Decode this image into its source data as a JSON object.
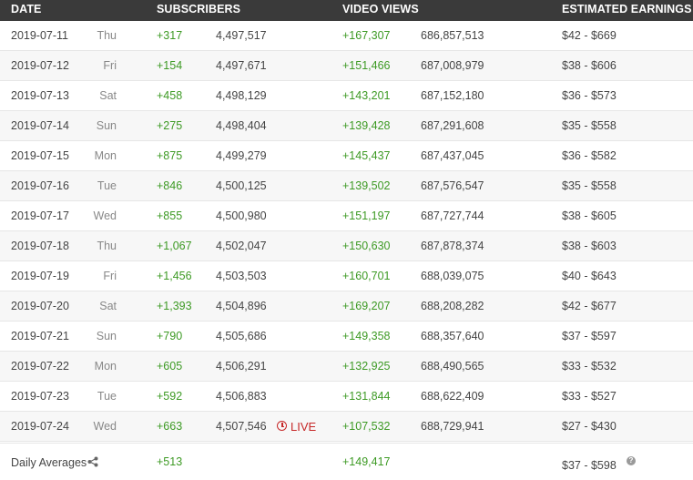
{
  "header": {
    "date": "DATE",
    "subscribers": "SUBSCRIBERS",
    "video_views": "VIDEO VIEWS",
    "estimated_earnings": "ESTIMATED EARNINGS"
  },
  "rows": [
    {
      "date": "2019-07-11",
      "day": "Thu",
      "sub_delta": "+317",
      "subs": "4,497,517",
      "views_delta": "+167,307",
      "views": "686,857,513",
      "earnings": "$42  -  $669"
    },
    {
      "date": "2019-07-12",
      "day": "Fri",
      "sub_delta": "+154",
      "subs": "4,497,671",
      "views_delta": "+151,466",
      "views": "687,008,979",
      "earnings": "$38  -  $606"
    },
    {
      "date": "2019-07-13",
      "day": "Sat",
      "sub_delta": "+458",
      "subs": "4,498,129",
      "views_delta": "+143,201",
      "views": "687,152,180",
      "earnings": "$36  -  $573"
    },
    {
      "date": "2019-07-14",
      "day": "Sun",
      "sub_delta": "+275",
      "subs": "4,498,404",
      "views_delta": "+139,428",
      "views": "687,291,608",
      "earnings": "$35  -  $558"
    },
    {
      "date": "2019-07-15",
      "day": "Mon",
      "sub_delta": "+875",
      "subs": "4,499,279",
      "views_delta": "+145,437",
      "views": "687,437,045",
      "earnings": "$36  -  $582"
    },
    {
      "date": "2019-07-16",
      "day": "Tue",
      "sub_delta": "+846",
      "subs": "4,500,125",
      "views_delta": "+139,502",
      "views": "687,576,547",
      "earnings": "$35  -  $558"
    },
    {
      "date": "2019-07-17",
      "day": "Wed",
      "sub_delta": "+855",
      "subs": "4,500,980",
      "views_delta": "+151,197",
      "views": "687,727,744",
      "earnings": "$38  -  $605"
    },
    {
      "date": "2019-07-18",
      "day": "Thu",
      "sub_delta": "+1,067",
      "subs": "4,502,047",
      "views_delta": "+150,630",
      "views": "687,878,374",
      "earnings": "$38  -  $603"
    },
    {
      "date": "2019-07-19",
      "day": "Fri",
      "sub_delta": "+1,456",
      "subs": "4,503,503",
      "views_delta": "+160,701",
      "views": "688,039,075",
      "earnings": "$40  -  $643"
    },
    {
      "date": "2019-07-20",
      "day": "Sat",
      "sub_delta": "+1,393",
      "subs": "4,504,896",
      "views_delta": "+169,207",
      "views": "688,208,282",
      "earnings": "$42  -  $677"
    },
    {
      "date": "2019-07-21",
      "day": "Sun",
      "sub_delta": "+790",
      "subs": "4,505,686",
      "views_delta": "+149,358",
      "views": "688,357,640",
      "earnings": "$37  -  $597"
    },
    {
      "date": "2019-07-22",
      "day": "Mon",
      "sub_delta": "+605",
      "subs": "4,506,291",
      "views_delta": "+132,925",
      "views": "688,490,565",
      "earnings": "$33  -  $532"
    },
    {
      "date": "2019-07-23",
      "day": "Tue",
      "sub_delta": "+592",
      "subs": "4,506,883",
      "views_delta": "+131,844",
      "views": "688,622,409",
      "earnings": "$33  -  $527"
    },
    {
      "date": "2019-07-24",
      "day": "Wed",
      "sub_delta": "+663",
      "subs": "4,507,546",
      "views_delta": "+107,532",
      "views": "688,729,941",
      "earnings": "$27  -  $430",
      "live_label": "LIVE"
    }
  ],
  "averages": {
    "label": "Daily Averages",
    "sub_delta": "+513",
    "views_delta": "+149,417",
    "earnings": "$37  -  $598"
  },
  "icons": {
    "share": "share-icon",
    "help": "help-icon",
    "live": "clock-icon"
  },
  "colors": {
    "header_bg": "#3a3a3a",
    "positive": "#3d9a24",
    "live": "#c62828"
  }
}
